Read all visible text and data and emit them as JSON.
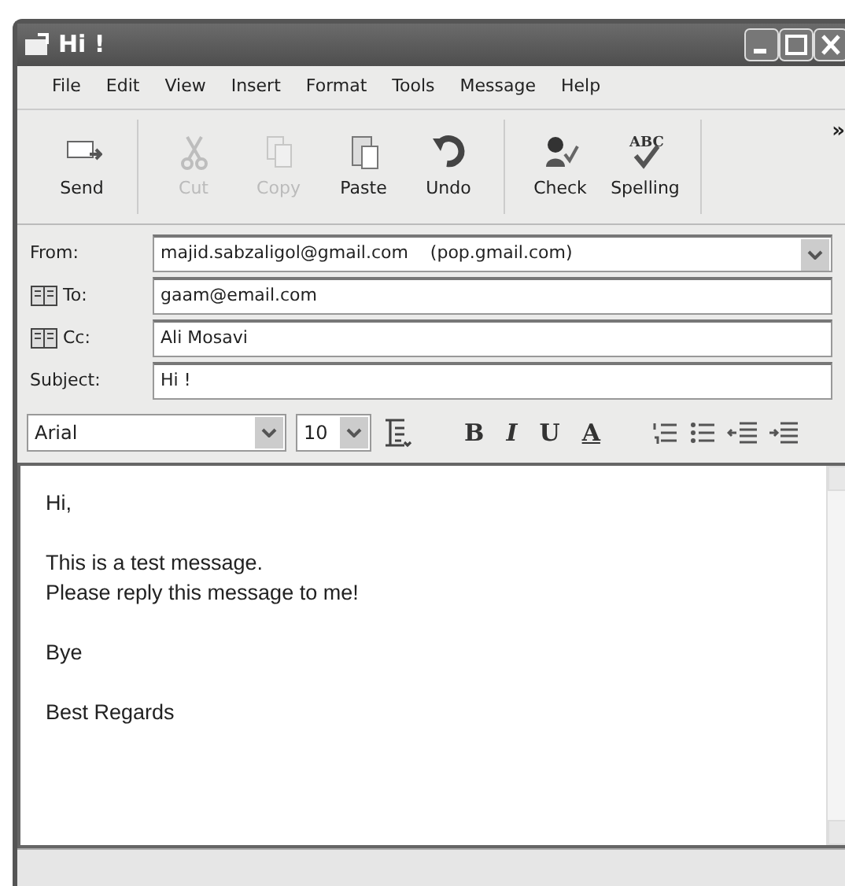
{
  "window": {
    "title": "Hi !"
  },
  "menu": [
    "File",
    "Edit",
    "View",
    "Insert",
    "Format",
    "Tools",
    "Message",
    "Help"
  ],
  "toolbar": [
    {
      "label": "Send",
      "kind": "send",
      "disabled": false
    },
    {
      "label": "Cut",
      "kind": "cut",
      "disabled": true
    },
    {
      "label": "Copy",
      "kind": "copy",
      "disabled": true
    },
    {
      "label": "Paste",
      "kind": "paste",
      "disabled": false
    },
    {
      "label": "Undo",
      "kind": "undo",
      "disabled": false
    },
    {
      "label": "Check",
      "kind": "check",
      "disabled": false
    },
    {
      "label": "Spelling",
      "kind": "spelling",
      "disabled": false,
      "icon_text": "ABC"
    }
  ],
  "toolbar_overflow": "»",
  "fields": [
    {
      "label": "From:",
      "kind": "select",
      "value": "majid.sabzaligol@gmail.com    (pop.gmail.com)"
    },
    {
      "label": "To:",
      "kind": "address",
      "value": "gaam@email.com"
    },
    {
      "label": "Cc:",
      "kind": "address",
      "value": "Ali Mosavi"
    },
    {
      "label": "Subject:",
      "kind": "text",
      "value": "Hi !"
    }
  ],
  "format_bar": {
    "font": "Arial",
    "size": "10",
    "bold": "B",
    "italic": "I",
    "underline": "U",
    "font_color": "A"
  },
  "body": [
    [
      "Hi,"
    ],
    [
      "This is a test message.",
      "Please reply this message to me!"
    ],
    [
      "Bye"
    ],
    [
      "Best Regards"
    ]
  ]
}
